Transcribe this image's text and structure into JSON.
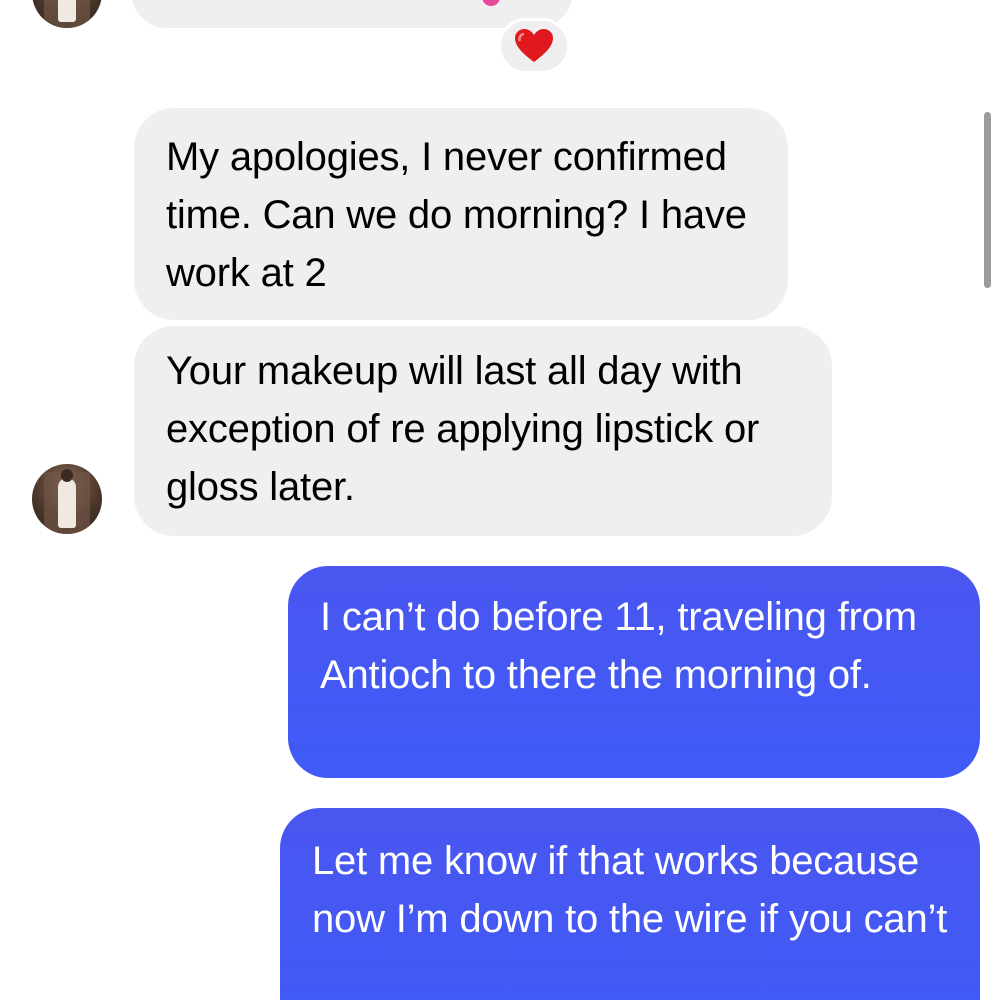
{
  "messages": [
    {
      "direction": "incoming",
      "text": "My apologies, I never confirmed time. Can we do morning? I have work at 2"
    },
    {
      "direction": "incoming",
      "text": "Your makeup will last all day with exception of re applying lipstick or gloss later."
    },
    {
      "direction": "outgoing",
      "text": "I can’t do before 11, traveling from Antioch to there the morning of."
    },
    {
      "direction": "outgoing",
      "text": "Let me know if that works because now I’m down to the wire if you can’t"
    }
  ],
  "reaction": {
    "icon": "heart-icon",
    "color": "#e0191f"
  },
  "colors": {
    "incoming_bubble": "#efeff0",
    "outgoing_bubble": "#4352f3",
    "background": "#ffffff"
  }
}
